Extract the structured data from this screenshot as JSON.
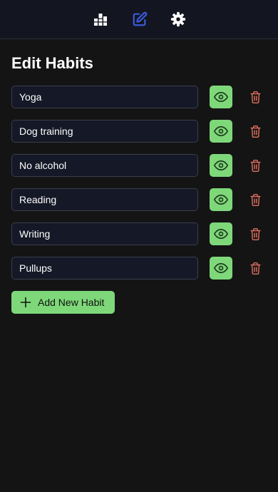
{
  "nav": {
    "items": [
      {
        "icon": "bar-chart-icon",
        "active": false
      },
      {
        "icon": "edit-icon",
        "active": true
      },
      {
        "icon": "gear-icon",
        "active": false
      }
    ],
    "active_color": "#3b5bdb",
    "inactive_color": "#ffffff"
  },
  "page": {
    "title": "Edit Habits"
  },
  "habits": [
    {
      "name": "Yoga"
    },
    {
      "name": "Dog training"
    },
    {
      "name": "No alcohol"
    },
    {
      "name": "Reading"
    },
    {
      "name": "Writing"
    },
    {
      "name": "Pullups"
    }
  ],
  "actions": {
    "add_label": "Add New Habit"
  },
  "colors": {
    "accent_green": "#7ed87a",
    "delete_red": "#e07060",
    "background": "#141414"
  }
}
